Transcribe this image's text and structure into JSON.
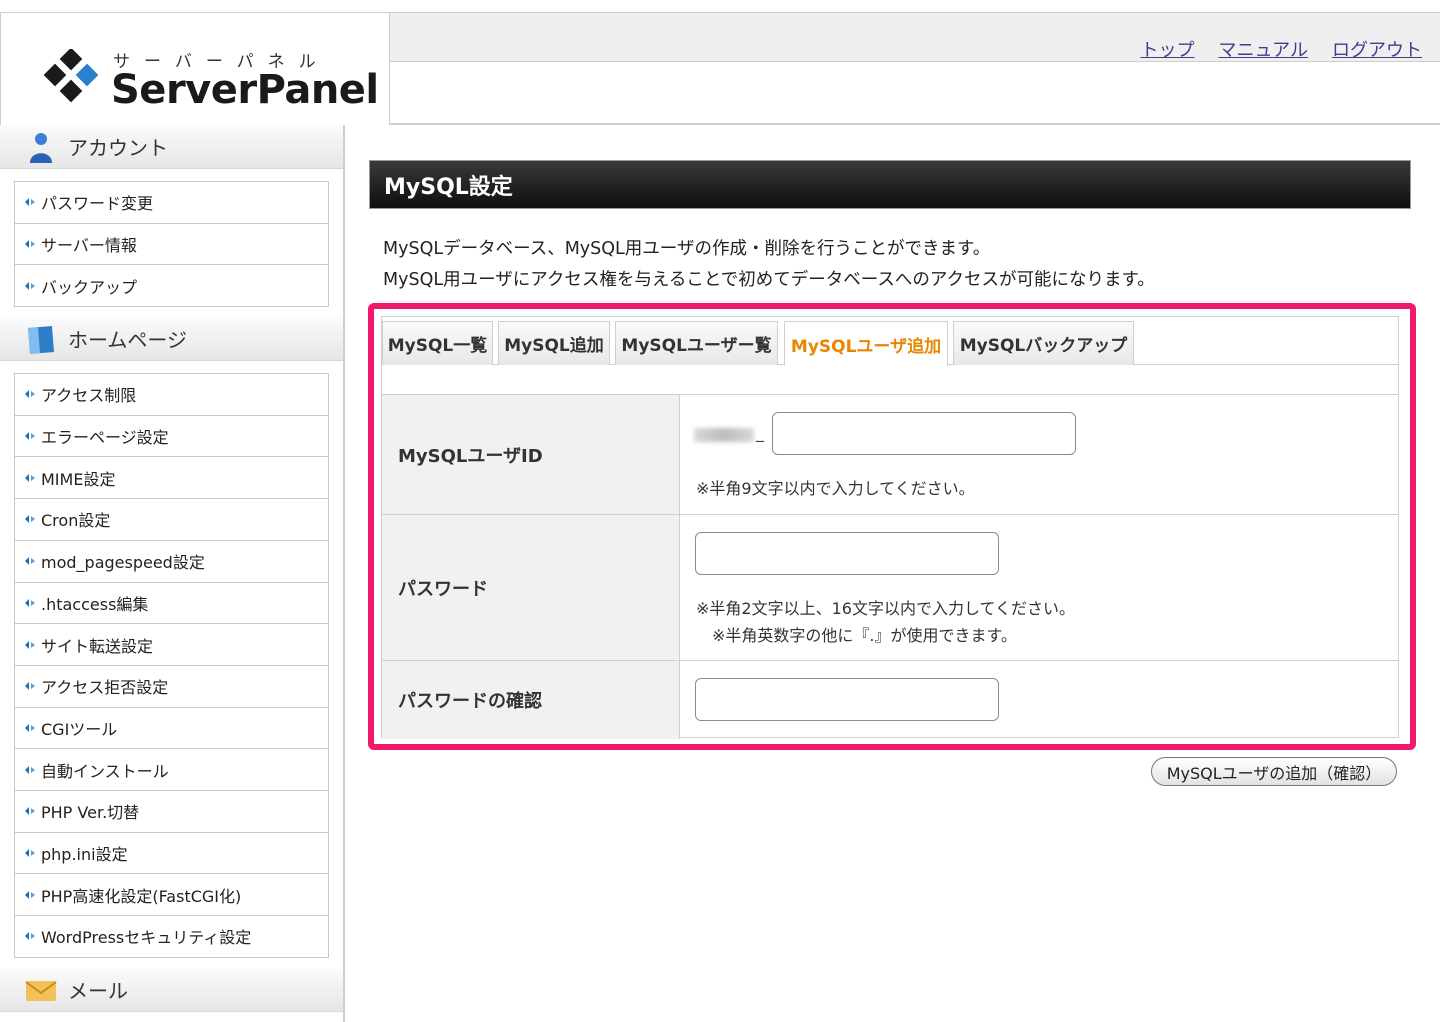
{
  "header": {
    "logo_kana": "サーバーパネル",
    "logo_text": "ServerPanel",
    "links": [
      "トップ",
      "マニュアル",
      "ログアウト"
    ]
  },
  "sidebar": {
    "sections": [
      {
        "title": "アカウント",
        "icon": "user-icon",
        "items": [
          "パスワード変更",
          "サーバー情報",
          "バックアップ"
        ]
      },
      {
        "title": "ホームページ",
        "icon": "book-icon",
        "items": [
          "アクセス制限",
          "エラーページ設定",
          "MIME設定",
          "Cron設定",
          "mod_pagespeed設定",
          ".htaccess編集",
          "サイト転送設定",
          "アクセス拒否設定",
          "CGIツール",
          "自動インストール",
          "PHP Ver.切替",
          "php.ini設定",
          "PHP高速化設定(FastCGI化)",
          "WordPressセキュリティ設定"
        ]
      },
      {
        "title": "メール",
        "icon": "envelope-icon",
        "items": []
      }
    ]
  },
  "main": {
    "title": "MySQL設定",
    "description": [
      "MySQLデータベース、MySQL用ユーザの作成・削除を行うことができます。",
      "MySQL用ユーザにアクセス権を与えることで初めてデータベースへのアクセスが可能になります。"
    ],
    "tabs": [
      {
        "label": "MySQL一覧",
        "active": false
      },
      {
        "label": "MySQL追加",
        "active": false
      },
      {
        "label": "MySQLユーザー覧",
        "active": false
      },
      {
        "label": "MySQLユーザ追加",
        "active": true
      },
      {
        "label": "MySQLバックアップ",
        "active": false
      }
    ],
    "form": {
      "user_id_label": "MySQLユーザID",
      "user_id_prefix_sep": "_",
      "user_id_value": "",
      "user_id_note": "※半角9文字以内で入力してください。",
      "password_label": "パスワード",
      "password_value": "",
      "password_note1": "※半角2文字以上、16文字以内で入力してください。",
      "password_note2": "※半角英数字の他に『.』が使用できます。",
      "confirm_label": "パスワードの確認",
      "confirm_value": ""
    },
    "submit_label": "MySQLユーザの追加（確認）"
  },
  "colors": {
    "highlight": "#f0196b",
    "active_tab": "#e88600",
    "link": "#4a3a8c",
    "arrow": "#1f6fb5"
  }
}
